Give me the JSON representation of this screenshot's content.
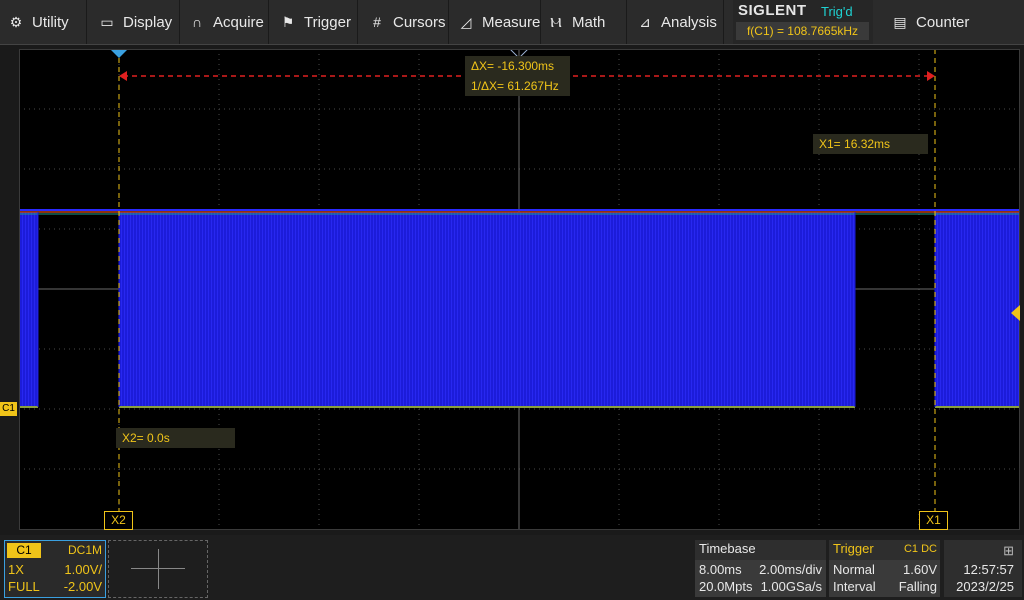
{
  "menu": {
    "utility": "Utility",
    "display": "Display",
    "acquire": "Acquire",
    "trigger": "Trigger",
    "cursors": "Cursors",
    "measure": "Measure",
    "math": "Math",
    "analysis": "Analysis",
    "counter": "Counter"
  },
  "brand": {
    "logo": "SIGLENT",
    "trig_status": "Trig'd",
    "frequency": "f(C1) = 108.7665kHz"
  },
  "cursors": {
    "delta_x": "ΔX= -16.300ms",
    "inv_delta_x": "1/ΔX= 61.267Hz",
    "x1_value": "X1= 16.32ms",
    "x2_value": "X2= 0.0s",
    "x1_tag": "X1",
    "x2_tag": "X2",
    "channel_marker": "C1"
  },
  "channel": {
    "name": "C1",
    "coupling": "DC1M",
    "probe": "1X",
    "scale": "1.00V/",
    "bandwidth": "FULL",
    "offset": "-2.00V"
  },
  "timebase": {
    "title": "Timebase",
    "delay": "8.00ms",
    "scale": "2.00ms/div",
    "memory": "20.0Mpts",
    "sample_rate": "1.00GSa/s"
  },
  "trigger": {
    "title": "Trigger",
    "source": "C1 DC",
    "mode": "Normal",
    "level": "1.60V",
    "type": "Interval",
    "slope": "Falling"
  },
  "clock": {
    "time": "12:57:57",
    "date": "2023/2/25"
  },
  "colors": {
    "waveform": "#1c1cd9",
    "channel_yellow": "#f0c419",
    "cursor_red": "#e02020",
    "trig_cyan": "#1fd3d3"
  }
}
